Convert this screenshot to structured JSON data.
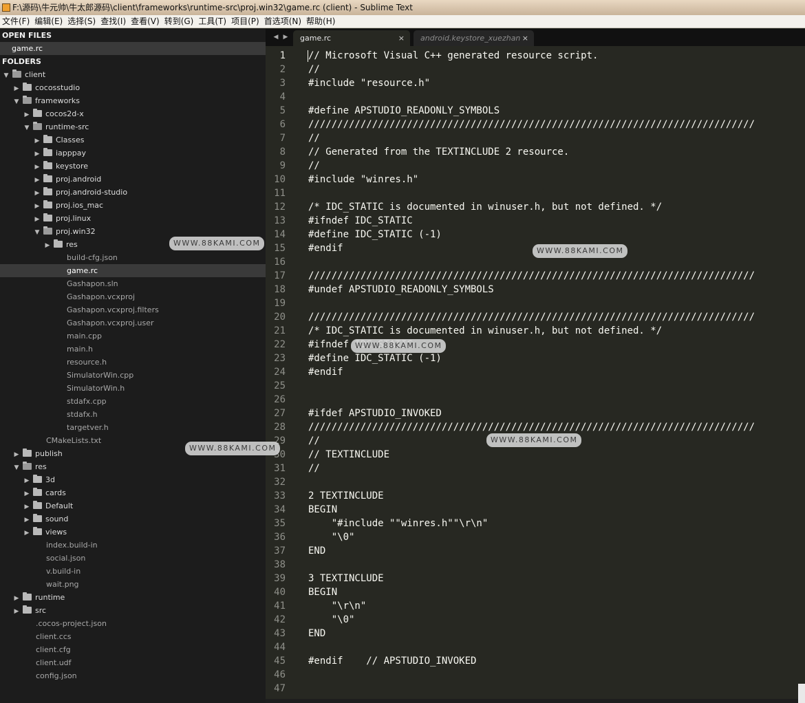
{
  "window": {
    "title": "F:\\源码\\牛元帅\\牛太郎源码\\client\\frameworks\\runtime-src\\proj.win32\\game.rc (client) - Sublime Text"
  },
  "menu": [
    "文件(F)",
    "编辑(E)",
    "选择(S)",
    "查找(I)",
    "查看(V)",
    "转到(G)",
    "工具(T)",
    "项目(P)",
    "首选项(N)",
    "帮助(H)"
  ],
  "sidebar": {
    "open_files_header": "OPEN FILES",
    "open_files": [
      "game.rc"
    ],
    "folders_header": "FOLDERS",
    "tree": [
      {
        "label": "client",
        "depth": 0,
        "type": "folder",
        "expanded": true
      },
      {
        "label": "cocosstudio",
        "depth": 1,
        "type": "folder",
        "expanded": false
      },
      {
        "label": "frameworks",
        "depth": 1,
        "type": "folder",
        "expanded": true
      },
      {
        "label": "cocos2d-x",
        "depth": 2,
        "type": "folder",
        "expanded": false
      },
      {
        "label": "runtime-src",
        "depth": 2,
        "type": "folder",
        "expanded": true
      },
      {
        "label": "Classes",
        "depth": 3,
        "type": "folder",
        "expanded": false
      },
      {
        "label": "iapppay",
        "depth": 3,
        "type": "folder",
        "expanded": false
      },
      {
        "label": "keystore",
        "depth": 3,
        "type": "folder",
        "expanded": false
      },
      {
        "label": "proj.android",
        "depth": 3,
        "type": "folder",
        "expanded": false
      },
      {
        "label": "proj.android-studio",
        "depth": 3,
        "type": "folder",
        "expanded": false
      },
      {
        "label": "proj.ios_mac",
        "depth": 3,
        "type": "folder",
        "expanded": false
      },
      {
        "label": "proj.linux",
        "depth": 3,
        "type": "folder",
        "expanded": false
      },
      {
        "label": "proj.win32",
        "depth": 3,
        "type": "folder",
        "expanded": true
      },
      {
        "label": "res",
        "depth": 4,
        "type": "folder",
        "expanded": false
      },
      {
        "label": "build-cfg.json",
        "depth": 4,
        "type": "file"
      },
      {
        "label": "game.rc",
        "depth": 4,
        "type": "file",
        "selected": true
      },
      {
        "label": "Gashapon.sln",
        "depth": 4,
        "type": "file"
      },
      {
        "label": "Gashapon.vcxproj",
        "depth": 4,
        "type": "file"
      },
      {
        "label": "Gashapon.vcxproj.filters",
        "depth": 4,
        "type": "file"
      },
      {
        "label": "Gashapon.vcxproj.user",
        "depth": 4,
        "type": "file"
      },
      {
        "label": "main.cpp",
        "depth": 4,
        "type": "file"
      },
      {
        "label": "main.h",
        "depth": 4,
        "type": "file"
      },
      {
        "label": "resource.h",
        "depth": 4,
        "type": "file"
      },
      {
        "label": "SimulatorWin.cpp",
        "depth": 4,
        "type": "file"
      },
      {
        "label": "SimulatorWin.h",
        "depth": 4,
        "type": "file"
      },
      {
        "label": "stdafx.cpp",
        "depth": 4,
        "type": "file"
      },
      {
        "label": "stdafx.h",
        "depth": 4,
        "type": "file"
      },
      {
        "label": "targetver.h",
        "depth": 4,
        "type": "file"
      },
      {
        "label": "CMakeLists.txt",
        "depth": 2,
        "type": "file"
      },
      {
        "label": "publish",
        "depth": 1,
        "type": "folder",
        "expanded": false
      },
      {
        "label": "res",
        "depth": 1,
        "type": "folder",
        "expanded": true
      },
      {
        "label": "3d",
        "depth": 2,
        "type": "folder",
        "expanded": false
      },
      {
        "label": "cards",
        "depth": 2,
        "type": "folder",
        "expanded": false
      },
      {
        "label": "Default",
        "depth": 2,
        "type": "folder",
        "expanded": false
      },
      {
        "label": "sound",
        "depth": 2,
        "type": "folder",
        "expanded": false
      },
      {
        "label": "views",
        "depth": 2,
        "type": "folder",
        "expanded": false
      },
      {
        "label": "index.build-in",
        "depth": 2,
        "type": "file"
      },
      {
        "label": "social.json",
        "depth": 2,
        "type": "file"
      },
      {
        "label": "v.build-in",
        "depth": 2,
        "type": "file"
      },
      {
        "label": "wait.png",
        "depth": 2,
        "type": "file"
      },
      {
        "label": "runtime",
        "depth": 1,
        "type": "folder",
        "expanded": false
      },
      {
        "label": "src",
        "depth": 1,
        "type": "folder",
        "expanded": false
      },
      {
        "label": ".cocos-project.json",
        "depth": 1,
        "type": "file"
      },
      {
        "label": "client.ccs",
        "depth": 1,
        "type": "file"
      },
      {
        "label": "client.cfg",
        "depth": 1,
        "type": "file"
      },
      {
        "label": "client.udf",
        "depth": 1,
        "type": "file"
      },
      {
        "label": "config.json",
        "depth": 1,
        "type": "file"
      }
    ]
  },
  "tabs": [
    {
      "label": "game.rc",
      "active": true
    },
    {
      "label": "android.keystore_xuezhan",
      "active": false
    }
  ],
  "tab_close_glyph": "×",
  "nav_prev_glyph": "◀",
  "nav_next_glyph": "▶",
  "editor": {
    "current_line": 1,
    "lines": [
      "// Microsoft Visual C++ generated resource script.",
      "//",
      "#include \"resource.h\"",
      "",
      "#define APSTUDIO_READONLY_SYMBOLS",
      "/////////////////////////////////////////////////////////////////////////////",
      "//",
      "// Generated from the TEXTINCLUDE 2 resource.",
      "//",
      "#include \"winres.h\"",
      "",
      "/* IDC_STATIC is documented in winuser.h, but not defined. */",
      "#ifndef IDC_STATIC",
      "#define IDC_STATIC (-1)",
      "#endif",
      "",
      "/////////////////////////////////////////////////////////////////////////////",
      "#undef APSTUDIO_READONLY_SYMBOLS",
      "",
      "/////////////////////////////////////////////////////////////////////////////",
      "/* IDC_STATIC is documented in winuser.h, but not defined. */",
      "#ifndef IDC_STATIC",
      "#define IDC_STATIC (-1)",
      "#endif",
      "",
      "",
      "#ifdef APSTUDIO_INVOKED",
      "/////////////////////////////////////////////////////////////////////////////",
      "//",
      "// TEXTINCLUDE",
      "//",
      "",
      "2 TEXTINCLUDE",
      "BEGIN",
      "    \"#include \"\"winres.h\"\"\\r\\n\"",
      "    \"\\0\"",
      "END",
      "",
      "3 TEXTINCLUDE",
      "BEGIN",
      "    \"\\r\\n\"",
      "    \"\\0\"",
      "END",
      "",
      "#endif    // APSTUDIO_INVOKED",
      "",
      ""
    ]
  },
  "watermark_text": "WWW.88KAMI.COM"
}
